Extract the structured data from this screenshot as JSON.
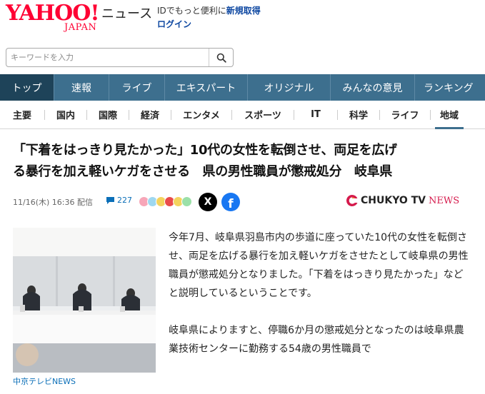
{
  "header": {
    "logo_main": "YAHOO!",
    "logo_sub": "JAPAN",
    "logo_news": "ニュース",
    "promo_text": "IDでもっと便利に",
    "promo_link": "新規取得",
    "login": "ログイン"
  },
  "search": {
    "placeholder": "キーワードを入力",
    "icon": "search-icon"
  },
  "primary_nav": [
    {
      "label": "トップ",
      "active": true
    },
    {
      "label": "速報",
      "active": false
    },
    {
      "label": "ライブ",
      "active": false
    },
    {
      "label": "エキスパート",
      "active": false
    },
    {
      "label": "オリジナル",
      "active": false
    },
    {
      "label": "みんなの意見",
      "active": false
    },
    {
      "label": "ランキング",
      "active": false
    }
  ],
  "secondary_nav": [
    {
      "label": "主要",
      "active": false
    },
    {
      "label": "国内",
      "active": false
    },
    {
      "label": "国際",
      "active": false
    },
    {
      "label": "経済",
      "active": false
    },
    {
      "label": "エンタメ",
      "active": false
    },
    {
      "label": "スポーツ",
      "active": false
    },
    {
      "label": "IT",
      "active": false
    },
    {
      "label": "科学",
      "active": false
    },
    {
      "label": "ライフ",
      "active": false
    },
    {
      "label": "地域",
      "active": true
    }
  ],
  "article": {
    "title_line1": "「下着をはっきり見たかった」10代の女性を転倒させ、両足を広げ",
    "title_line2": "る暴行を加え軽いケガをさせる　県の男性職員が懲戒処分　岐阜県",
    "date": "11/16(木) 16:36 配信",
    "comment_count": "227",
    "source_name": "CHUKYO TV",
    "source_suffix": "NEWS",
    "image_caption": "中京テレビNEWS",
    "paragraphs": [
      "今年7月、岐阜県羽島市内の歩道に座っていた10代の女性を転倒させ、両足を広げる暴行を加え軽いケガをさせたとして岐阜県の男性職員が懲戒処分となりました。「下着をはっきり見たかった」などと説明しているということです。",
      "岐阜県によりますと、停職6か月の懲戒処分となったのは岐阜県農業技術センターに勤務する54歳の男性職員で"
    ]
  },
  "colors": {
    "brand_red": "#ff0033",
    "nav_blue": "#3d6f8e",
    "nav_active": "#1e4359",
    "link_blue": "#0b6fb8",
    "x_black": "#000000",
    "facebook_blue": "#1877f2",
    "chukyo_pink": "#d51a4c"
  },
  "icons": [
    "search-icon",
    "comment-icon",
    "reaction-emoji-icon",
    "x-share-icon",
    "facebook-share-icon",
    "chukyo-tv-logo-icon"
  ]
}
